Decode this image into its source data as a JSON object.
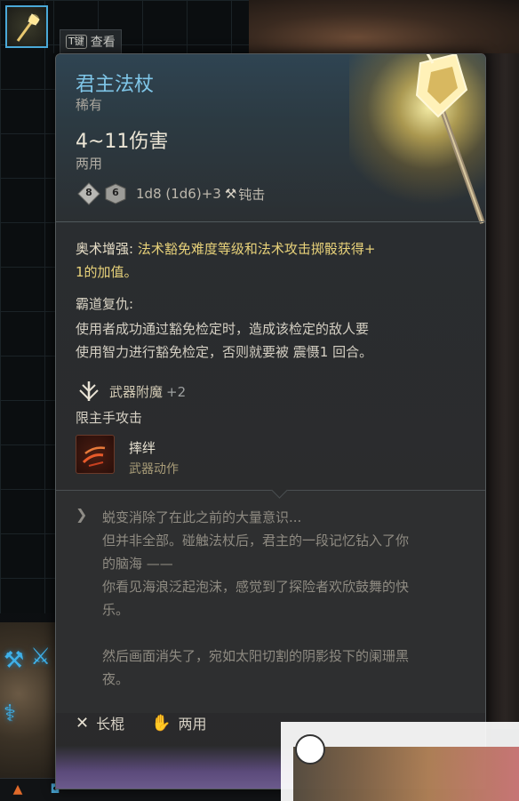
{
  "slot": {
    "hint_key": "T键",
    "hint_label": "查看"
  },
  "item": {
    "name": "君主法杖",
    "rarity": "稀有",
    "damage": "4~11伤害",
    "handedness": "两用",
    "dice": {
      "die1": "8",
      "die2": "6",
      "formula": "1d8 (1d6)+3",
      "damage_type": "钝击"
    }
  },
  "abilities": {
    "arcane": {
      "name": "奥术增强:",
      "desc_line1": " 法术豁免难度等级和法术攻击掷骰获得+",
      "desc_line2": "1的加值。"
    },
    "passive": {
      "title": "霸道复仇:",
      "line1": "使用者成功通过豁免检定时，造成该检定的敌人要",
      "line2": "使用智力进行豁免检定，否则就要被 震慑1 回合。"
    },
    "enchant": {
      "label": "武器附魔",
      "bonus": "+2"
    },
    "mainhand_only": "限主手攻击",
    "action": {
      "name": "摔绊",
      "type": "武器动作"
    }
  },
  "lore": {
    "line1": "蜕变消除了在此之前的大量意识...",
    "line2": "但并非全部。碰触法杖后，君主的一段记忆钻入了你",
    "line3": "的脑海 ——",
    "line4": "你看见海浪泛起泡沫，感觉到了探险者欢欣鼓舞的快",
    "line5": "乐。",
    "line6": "然后画面消失了，宛如太阳切割的阴影投下的阑珊黑",
    "line7": "夜。"
  },
  "footer": {
    "weapon_type": "长棍",
    "hands": "两用"
  },
  "colors": {
    "name_blue": "#7fc6e8",
    "ability_gold": "#e8d27a",
    "lore_gray": "#8f8b82",
    "slot_border": "#4aa9d8"
  },
  "icons": {
    "item": "staff-icon",
    "damage_type": "hammer-icon",
    "enchant": "enchant-sigil-icon",
    "action": "topple-icon",
    "lore": "scroll-icon",
    "weapon": "crossed-staffs-icon",
    "hands": "hand-icon"
  }
}
